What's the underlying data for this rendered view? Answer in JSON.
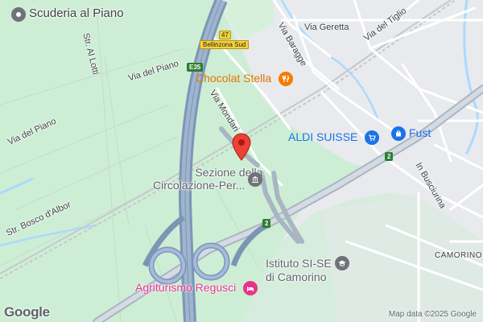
{
  "map": {
    "labels": {
      "scuderia": "Scuderia al Piano",
      "str_al_lotti": "Str. Al Lotti",
      "via_del_piano_1": "Via del Piano",
      "via_del_piano_2": "Via del Piano",
      "str_bosco": "Str. Bosco d'Albor",
      "via_mondari": "Via Mondari",
      "via_baragge": "Via Baragge",
      "via_geretta": "Via Geretta",
      "via_del_tiglio": "Via del Tiglio",
      "chocolat": "Chocolat Stella",
      "aldi": "ALDI SUISSE",
      "fust": "Fust",
      "sezione_1": "Sezione della",
      "sezione_2": "Circolazione-Per...",
      "in_busciurina": "In Busciurina",
      "istituto_1": "Istituto SI-SE",
      "istituto_2": "di Camorino",
      "camorino": "CAMORINO",
      "agriturismo": "Agriturismo Regusci"
    },
    "shields": {
      "exit_number": "47",
      "exit_name": "Bellinzona Sud",
      "e35": "E35",
      "route2_a": "2",
      "route2_b": "2"
    },
    "branding": {
      "logo": "Google",
      "attribution": "Map data ©2025 Google"
    },
    "colors": {
      "park": "#cdeed5",
      "urban": "#e8eaed",
      "water": "#aadaff",
      "motorway": "#8ea6c5",
      "marker": "#ea4335",
      "shopping": "#1a73e8",
      "food": "#f57c00",
      "civic": "#5f6368",
      "hotel": "#e8338a"
    },
    "icons": {
      "pin": "map-pin-icon",
      "scuderia": "place-icon",
      "chocolat": "restaurant-icon",
      "aldi": "shopping-cart-icon",
      "fust": "shopping-bag-icon",
      "sezione": "government-icon",
      "istituto": "school-icon",
      "agriturismo": "bed-icon"
    }
  }
}
